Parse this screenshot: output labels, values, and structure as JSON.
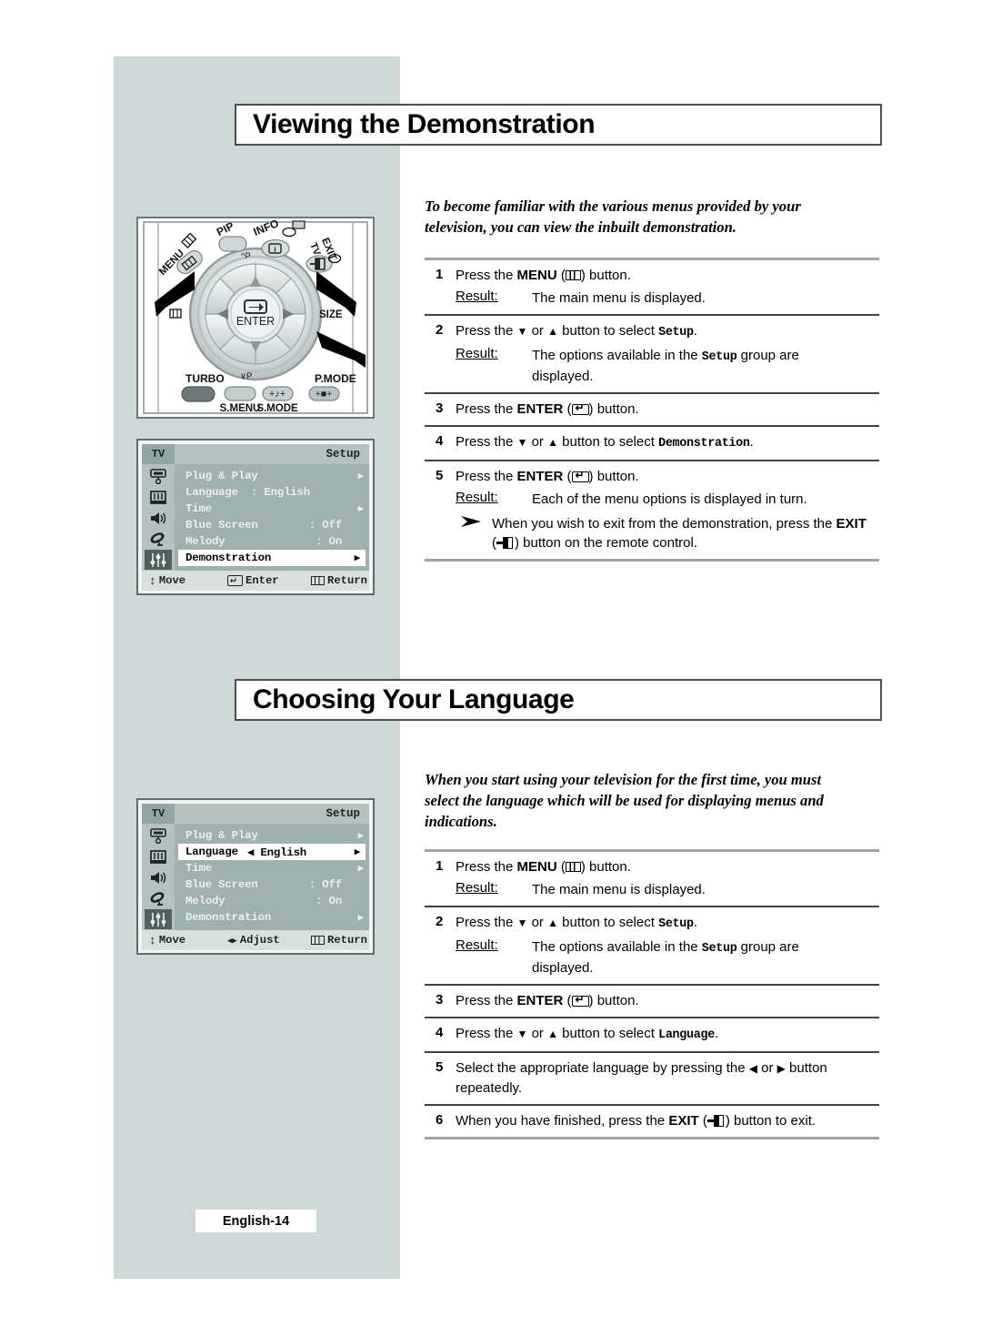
{
  "page": {
    "footer_label": "English-14"
  },
  "sections": [
    {
      "id": "demonstration",
      "title": "Viewing the Demonstration",
      "intro": "To become familiar with the various menus provided by your television, you can view the inbuilt demonstration.",
      "steps": [
        {
          "num": "1",
          "text_parts": [
            "Press the ",
            "MENU",
            " (",
            "menu-icon",
            ") button."
          ],
          "instruction": "Press the MENU (menu-icon) button.",
          "result_label": "Result:",
          "result_text": "The main menu is displayed."
        },
        {
          "num": "2",
          "instruction": "Press the ▼ or ▲ button to select Setup.",
          "target": "Setup",
          "result_label": "Result:",
          "result_text": "The options available in the Setup group are displayed.",
          "result_text_a": "The options available in the ",
          "result_text_b": "Setup",
          "result_text_c": " group are displayed."
        },
        {
          "num": "3",
          "instruction": "Press the ENTER (enter-icon) button."
        },
        {
          "num": "4",
          "instruction": "Press the ▼ or ▲ button to select Demonstration.",
          "target": "Demonstration"
        },
        {
          "num": "5",
          "instruction": "Press the ENTER (enter-icon) button.",
          "result_label": "Result:",
          "result_text": "Each of the menu options is displayed in turn.",
          "note": "When you wish to exit from the demonstration, press the EXIT (exit-icon) button on the remote control."
        }
      ]
    },
    {
      "id": "language",
      "title": "Choosing Your Language",
      "intro": "When you start using your television for the first time, you must select the language which will be used for displaying menus and indications.",
      "steps": [
        {
          "num": "1",
          "instruction": "Press the MENU (menu-icon) button.",
          "result_label": "Result:",
          "result_text": "The main menu is displayed."
        },
        {
          "num": "2",
          "instruction": "Press the ▼ or ▲ button to select Setup.",
          "target": "Setup",
          "result_label": "Result:",
          "result_text_a": "The options available in the ",
          "result_text_b": "Setup",
          "result_text_c": " group are displayed."
        },
        {
          "num": "3",
          "instruction": "Press the ENTER (enter-icon) button."
        },
        {
          "num": "4",
          "instruction": "Press the ▼ or ▲ button to select Language.",
          "target": "Language"
        },
        {
          "num": "5",
          "instruction": "Select the appropriate language by pressing the ◀ or ▶ button repeatedly."
        },
        {
          "num": "6",
          "instruction": "When you have finished, press the EXIT (exit-icon) button to exit."
        }
      ]
    }
  ],
  "text_fragments": {
    "press_the": "Press the ",
    "button_period": " button.",
    "menu_word": "MENU",
    "enter_word": "ENTER",
    "exit_word": "EXIT",
    "or_word": " or ",
    "button_to_select": " button to select ",
    "period": ".",
    "result_label": "Result:",
    "main_menu_displayed": "The main menu is displayed.",
    "options_available_pre": "The options available in the ",
    "options_available_post": " group are displayed.",
    "each_menu_option": "Each of the menu options is displayed in turn.",
    "note_exit_pre": "When you wish to exit from the demonstration, press the ",
    "note_exit_post": " button on the remote control.",
    "setup_word": "Setup",
    "demonstration_word": "Demonstration",
    "language_word": "Language",
    "select_lang_pre": "Select the appropriate language by pressing the ",
    "select_lang_post": " button repeatedly.",
    "finished_pre": "When you have finished, press the ",
    "finished_post": " button to exit.",
    "open_paren": " (",
    "close_paren": ") ",
    "close_paren_plain": ")"
  },
  "osd_menus": [
    {
      "id": "osd-demonstration",
      "tv_label": "TV",
      "group_label": "Setup",
      "rows": [
        {
          "label": "Plug & Play",
          "value": "",
          "arrow": true,
          "selected": false
        },
        {
          "label": "Language",
          "value": ": English",
          "arrow": false,
          "selected": false
        },
        {
          "label": "Time",
          "value": "",
          "arrow": true,
          "selected": false
        },
        {
          "label": "Blue Screen",
          "value": ": Off",
          "arrow": false,
          "selected": false
        },
        {
          "label": "Melody",
          "value": ": On",
          "arrow": false,
          "selected": false
        },
        {
          "label": "Demonstration",
          "value": "",
          "arrow": true,
          "selected": true
        }
      ],
      "footer": {
        "move": "Move",
        "middle": "Enter",
        "middle_icon": "enter-icon",
        "return": "Return"
      },
      "icons": [
        "picture-icon",
        "channel-icon",
        "sound-icon",
        "satellite-icon",
        "setup-sliders-icon"
      ],
      "active_icon_index": 4
    },
    {
      "id": "osd-language",
      "tv_label": "TV",
      "group_label": "Setup",
      "rows": [
        {
          "label": "Plug & Play",
          "value": "",
          "arrow": true,
          "selected": false
        },
        {
          "label": "Language",
          "value": "◀ English",
          "arrow": true,
          "selected": true
        },
        {
          "label": "Time",
          "value": "",
          "arrow": true,
          "selected": false
        },
        {
          "label": "Blue Screen",
          "value": ": Off",
          "arrow": false,
          "selected": false
        },
        {
          "label": "Melody",
          "value": ": On",
          "arrow": false,
          "selected": false
        },
        {
          "label": "Demonstration",
          "value": "",
          "arrow": true,
          "selected": false
        }
      ],
      "footer": {
        "move": "Move",
        "middle": "Adjust",
        "middle_icon": "left-right-icon",
        "return": "Return"
      },
      "icons": [
        "picture-icon",
        "channel-icon",
        "sound-icon",
        "satellite-icon",
        "setup-sliders-icon"
      ],
      "active_icon_index": 4
    }
  ],
  "remote": {
    "labels": {
      "menu": "MENU",
      "pip": "PIP",
      "info": "INFO",
      "exit": "EXIT",
      "tv": "TV",
      "enter": "ENTER",
      "p_up": "P",
      "p_down": "P",
      "turbo": "TURBO",
      "s_menu": "S.MENU",
      "s_mode": "S.MODE",
      "p_mode": "P.MODE",
      "size": "SIZE"
    }
  }
}
